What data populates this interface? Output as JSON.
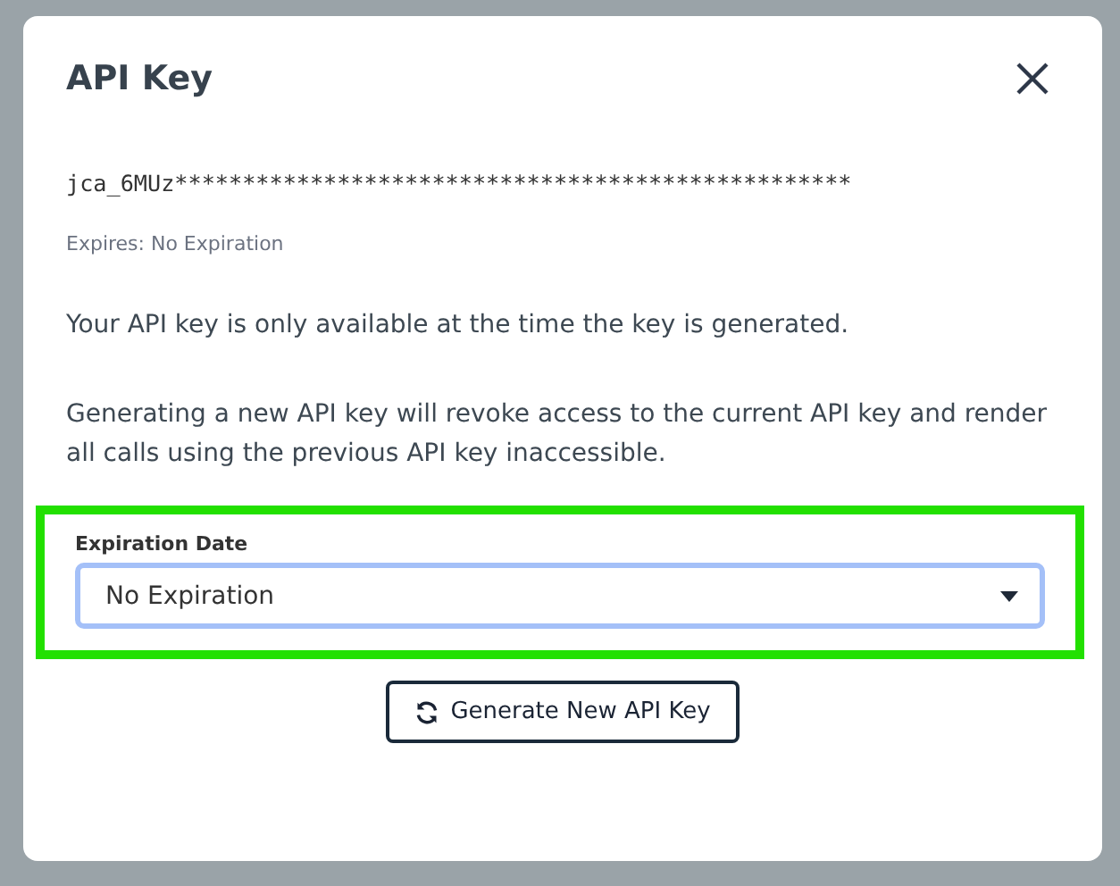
{
  "dialog": {
    "title": "API Key"
  },
  "api_key": "jca_6MUz**************************************************",
  "expires": "Expires: No Expiration",
  "paragraphs": [
    "Your API key is only available at the time the key is generated.",
    "Generating a new API key will revoke access to the current API key and render all calls using the previous API key inaccessible."
  ],
  "expiration_field": {
    "label": "Expiration Date",
    "value": "No Expiration",
    "focused": true,
    "highlighted": true
  },
  "generate_button": {
    "label": "Generate New API Key"
  }
}
